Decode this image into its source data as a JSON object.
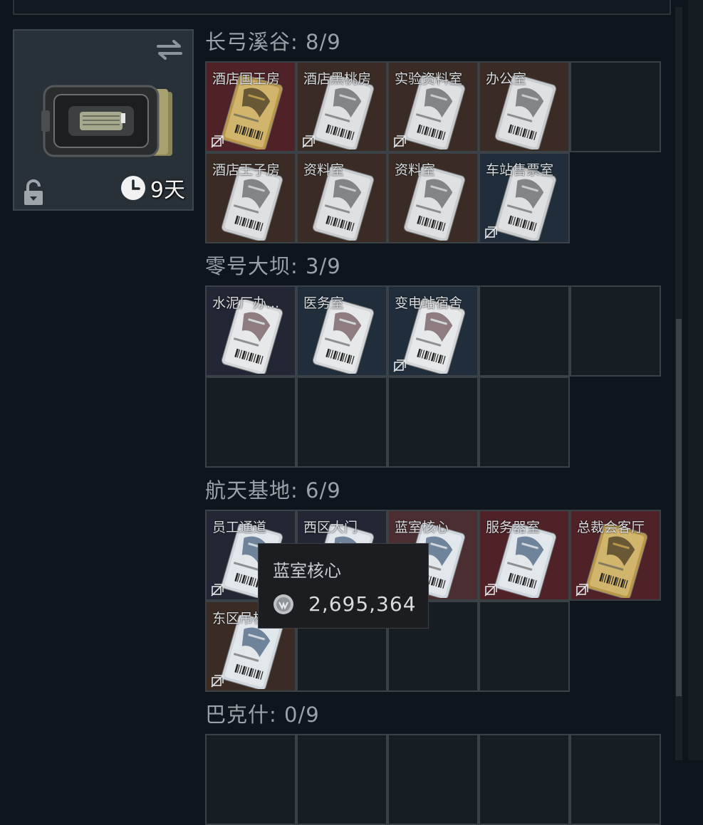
{
  "container": {
    "timer": "9天"
  },
  "sections": [
    {
      "title": "长弓溪谷: 8/9",
      "slots": [
        {
          "label": "酒店国王房",
          "theme": "red",
          "card": "gold",
          "nolink": true
        },
        {
          "label": "酒店黑桃房",
          "theme": "brown",
          "card": "silver",
          "nolink": true
        },
        {
          "label": "实验资料室",
          "theme": "brown",
          "card": "silver",
          "nolink": true
        },
        {
          "label": "办公室",
          "theme": "brown",
          "card": "silver",
          "nolink": false
        },
        {
          "label": "",
          "theme": "empty",
          "card": "",
          "nolink": false
        },
        {
          "label": "酒店王子房",
          "theme": "brown",
          "card": "silver",
          "nolink": false
        },
        {
          "label": "资料室",
          "theme": "brown",
          "card": "silver",
          "nolink": false
        },
        {
          "label": "资料室",
          "theme": "brown",
          "card": "silver",
          "nolink": false
        },
        {
          "label": "车站售票室",
          "theme": "slate",
          "card": "silver",
          "nolink": true
        }
      ]
    },
    {
      "title": "零号大坝: 3/9",
      "slots": [
        {
          "label": "水泥厂办...",
          "theme": "dark",
          "card": "white",
          "nolink": false
        },
        {
          "label": "医务室",
          "theme": "slate",
          "card": "white",
          "nolink": false
        },
        {
          "label": "变电站宿舍",
          "theme": "slate",
          "card": "white",
          "nolink": true
        },
        {
          "label": "",
          "theme": "empty",
          "card": "",
          "nolink": false
        },
        {
          "label": "",
          "theme": "empty",
          "card": "",
          "nolink": false
        },
        {
          "label": "",
          "theme": "empty",
          "card": "",
          "nolink": false
        },
        {
          "label": "",
          "theme": "empty",
          "card": "",
          "nolink": false
        },
        {
          "label": "",
          "theme": "empty",
          "card": "",
          "nolink": false
        },
        {
          "label": "",
          "theme": "empty",
          "card": "",
          "nolink": false
        }
      ]
    },
    {
      "title": "航天基地: 6/9",
      "slots": [
        {
          "label": "员工通道",
          "theme": "dark",
          "card": "blue",
          "nolink": true
        },
        {
          "label": "西区大门",
          "theme": "dark",
          "card": "blue",
          "nolink": false
        },
        {
          "label": "蓝室核心",
          "theme": "rose",
          "card": "blue",
          "nolink": false
        },
        {
          "label": "服务器室",
          "theme": "red",
          "card": "blue",
          "nolink": true
        },
        {
          "label": "总裁会客厅",
          "theme": "red",
          "card": "gold",
          "nolink": true
        },
        {
          "label": "东区吊桥",
          "theme": "brown",
          "card": "blue",
          "nolink": true
        },
        {
          "label": "",
          "theme": "empty",
          "card": "",
          "nolink": false
        },
        {
          "label": "",
          "theme": "empty",
          "card": "",
          "nolink": false
        },
        {
          "label": "",
          "theme": "empty",
          "card": "",
          "nolink": false
        }
      ]
    },
    {
      "title": "巴克什: 0/9",
      "slots": [
        {
          "label": "",
          "theme": "empty",
          "card": "",
          "nolink": false
        },
        {
          "label": "",
          "theme": "empty",
          "card": "",
          "nolink": false
        },
        {
          "label": "",
          "theme": "empty",
          "card": "",
          "nolink": false
        },
        {
          "label": "",
          "theme": "empty",
          "card": "",
          "nolink": false
        },
        {
          "label": "",
          "theme": "empty",
          "card": "",
          "nolink": false
        }
      ]
    }
  ],
  "tooltip": {
    "name": "蓝室核心",
    "price": "2,695,364"
  }
}
